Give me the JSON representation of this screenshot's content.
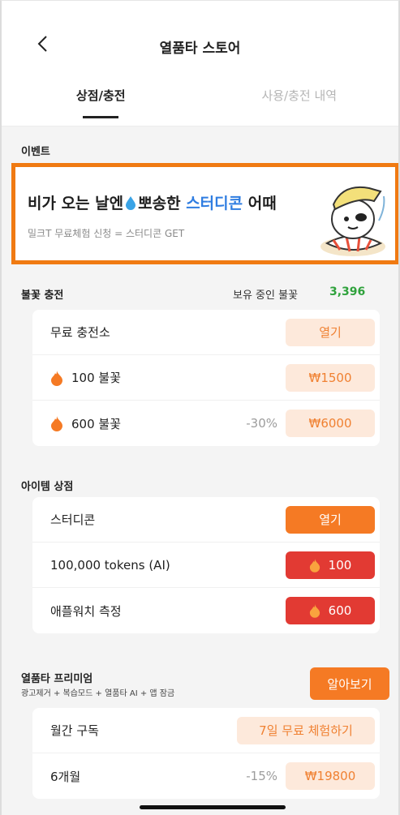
{
  "header": {
    "title": "열품타 스토어",
    "tabs": [
      {
        "label": "상점/충전",
        "active": true
      },
      {
        "label": "사용/충전 내역",
        "active": false
      }
    ]
  },
  "event": {
    "section_label": "이벤트",
    "banner_title_part1": "비가 오는 날엔",
    "banner_title_part2": "뽀송한",
    "banner_title_highlight": "스터디콘",
    "banner_title_part3": "어때",
    "banner_subtitle": "밀크T 무료체험 신청 = 스터디콘 GET"
  },
  "charge": {
    "section_label": "불꽃 충전",
    "points_label": "보유 중인 불꽃",
    "points_value": "3,396",
    "rows": [
      {
        "label": "무료 충전소",
        "button": "열기",
        "icon": null,
        "discount": ""
      },
      {
        "label": "100 불꽃",
        "button": "₩1500",
        "icon": "fire-icon",
        "discount": ""
      },
      {
        "label": "600 불꽃",
        "button": "₩6000",
        "icon": "fire-icon",
        "discount": "-30%"
      }
    ]
  },
  "items": {
    "section_label": "아이템 상점",
    "rows": [
      {
        "label": "스터디콘",
        "button": "열기"
      },
      {
        "label": "100,000 tokens (AI)",
        "button": "100"
      },
      {
        "label": "애플워치 측정",
        "button": "600"
      }
    ]
  },
  "premium": {
    "title": "열품타 프리미엄",
    "subtitle": "광고제거 + 복습모드 + 열품타 AI + 앱 잠금",
    "learn_button": "알아보기",
    "rows": [
      {
        "label": "월간 구독",
        "button": "7일 무료 체험하기",
        "discount": ""
      },
      {
        "label": "6개월",
        "button": "₩19800",
        "discount": "-15%"
      }
    ]
  },
  "colors": {
    "accent_orange": "#f57a24",
    "red": "#e23a33",
    "light_orange_bg": "#fde9db",
    "green": "#2fa23c",
    "blue_highlight": "#2f7de1",
    "banner_border": "#f07a12"
  }
}
